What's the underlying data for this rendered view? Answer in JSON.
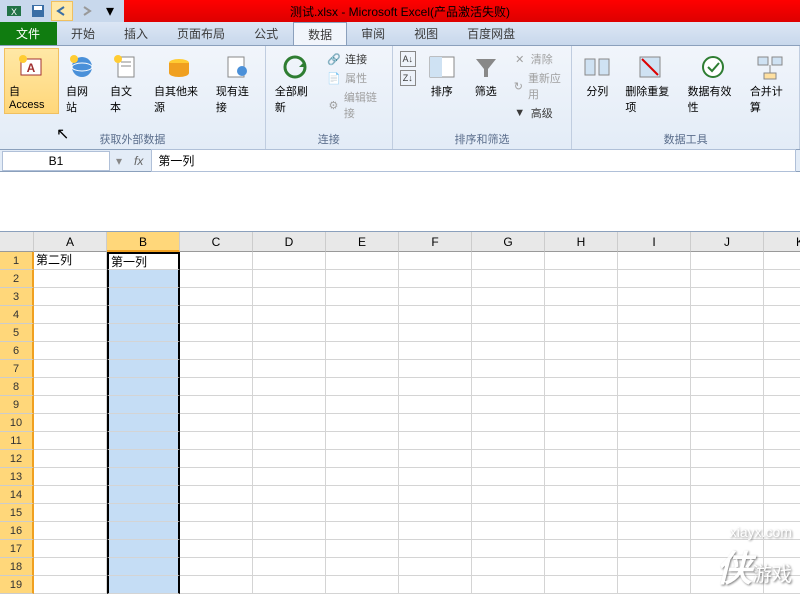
{
  "title": "测试.xlsx - Microsoft Excel(产品激活失败)",
  "tabs": {
    "file": "文件",
    "home": "开始",
    "insert": "插入",
    "layout": "页面布局",
    "formula": "公式",
    "data": "数据",
    "review": "审阅",
    "view": "视图",
    "baidu": "百度网盘"
  },
  "ribbon": {
    "ext": {
      "access": "自 Access",
      "web": "自网站",
      "text": "自文本",
      "other": "自其他来源",
      "existing": "现有连接",
      "label": "获取外部数据"
    },
    "conn": {
      "refresh": "全部刷新",
      "connections": "连接",
      "properties": "属性",
      "editlinks": "编辑链接",
      "label": "连接"
    },
    "sort": {
      "az": "A↓Z",
      "za": "Z↓A",
      "sort": "排序",
      "filter": "筛选",
      "clear": "清除",
      "reapply": "重新应用",
      "advanced": "高级",
      "label": "排序和筛选"
    },
    "tools": {
      "text2col": "分列",
      "dedup": "删除重复项",
      "validation": "数据有效性",
      "consolidate": "合并计算",
      "label": "数据工具"
    }
  },
  "namebox": "B1",
  "fx": "fx",
  "formula_value": "第一列",
  "cols": [
    "A",
    "B",
    "C",
    "D",
    "E",
    "F",
    "G",
    "H",
    "I",
    "J",
    "K"
  ],
  "rows": [
    "1",
    "2",
    "3",
    "4",
    "5",
    "6",
    "7",
    "8",
    "9",
    "10",
    "11",
    "12",
    "13",
    "14",
    "15",
    "16",
    "17",
    "18",
    "19"
  ],
  "cells": {
    "A1": "第二列",
    "B1": "第一列"
  },
  "watermark": {
    "site": "xiayx.com",
    "brand": "侠",
    "sub": "游戏"
  }
}
